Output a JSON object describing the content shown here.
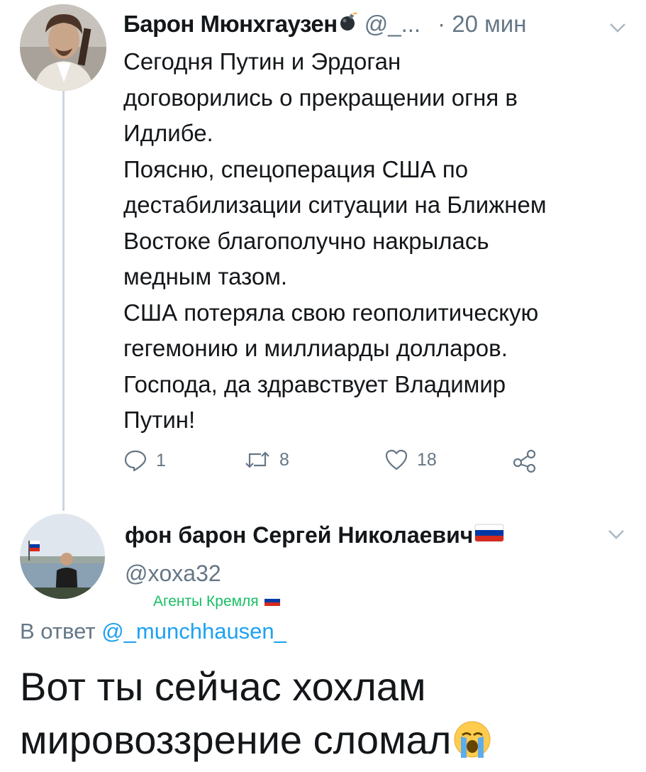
{
  "tweet1": {
    "author_name": "Барон Мюнхгаузен",
    "name_emoji": "bomb-emoji",
    "handle": "@_...",
    "time": "· 20 мин",
    "text": "Сегодня Путин и Эрдоган\nдоговорились о прекращении огня в\nИдлибе.\nПоясню, спецоперация США по\nдестабилизации ситуации на Ближнем\nВостоке благополучно накрылась\nмедным тазом.\nСША потеряла свою геополитическую\nгегемонию и миллиарды долларов.\nГоспода, да здравствует Владимир\nПутин!",
    "actions": {
      "reply_count": "1",
      "retweet_count": "8",
      "like_count": "18"
    }
  },
  "tweet2": {
    "author_name": "фон барон Сергей Николаевич",
    "name_emoji": "russia-flag-emoji",
    "handle": "@xoxa32",
    "badge": "Агенты Кремля",
    "reply_prefix": "В ответ",
    "reply_mention": "@_munchhausen_",
    "text": "Вот ты сейчас хохлам\nмировоззрение сломал",
    "text_emoji": "loudly-crying-face-emoji"
  },
  "colors": {
    "text": "#14171a",
    "secondary": "#657786",
    "link": "#1da1f2",
    "badge": "#17bf63",
    "thread_line": "#ccd6dd"
  }
}
